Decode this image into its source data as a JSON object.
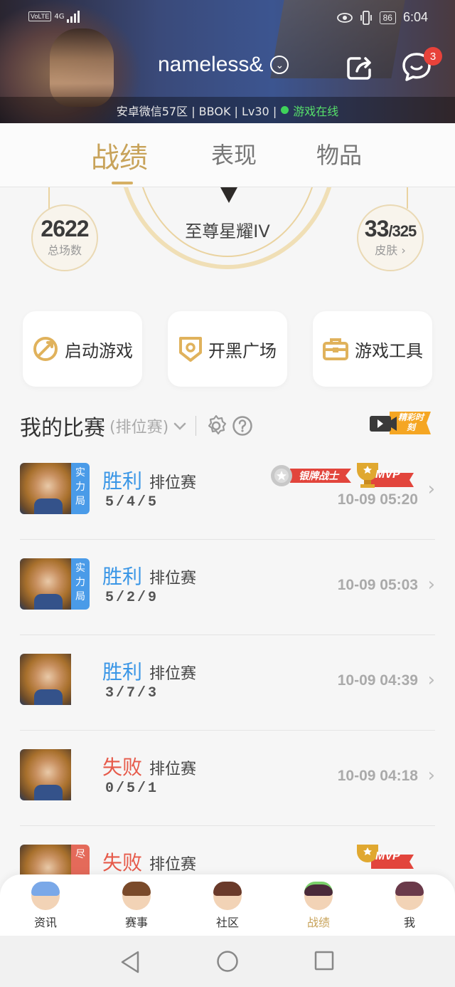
{
  "status_bar": {
    "network": "4G",
    "volte": "VoLTE",
    "battery": "86",
    "time": "6:04"
  },
  "header": {
    "username": "nameless&",
    "message_badge": "3",
    "info_text": "安卓微信57区 | BBOK | Lv30 |",
    "online_text": "游戏在线"
  },
  "tabs": [
    {
      "label": "战绩",
      "active": true
    },
    {
      "label": "表现",
      "active": false
    },
    {
      "label": "物品",
      "active": false
    }
  ],
  "profile_stats": {
    "matches_count": "2622",
    "matches_label": "总场数",
    "rank_name": "至尊星耀IV",
    "skins_owned": "33",
    "skins_total": "/325",
    "skins_label": "皮肤"
  },
  "quick_actions": [
    {
      "label": "启动游戏",
      "icon": "launch-game-icon"
    },
    {
      "label": "开黑广场",
      "icon": "team-plaza-icon"
    },
    {
      "label": "游戏工具",
      "icon": "game-tools-icon"
    }
  ],
  "my_matches": {
    "title": "我的比赛",
    "filter": "(排位赛)",
    "highlight_label": "精彩时刻"
  },
  "matches": [
    {
      "result": "胜利",
      "type": "win",
      "mode": "排位赛",
      "kda": "5/4/5",
      "time": "10-09 05:20",
      "tag": "实力局",
      "badges": [
        "银牌战士",
        "MVP"
      ]
    },
    {
      "result": "胜利",
      "type": "win",
      "mode": "排位赛",
      "kda": "5/2/9",
      "time": "10-09 05:03",
      "tag": "实力局",
      "badges": []
    },
    {
      "result": "胜利",
      "type": "win",
      "mode": "排位赛",
      "kda": "3/7/3",
      "time": "10-09 04:39",
      "tag": "",
      "badges": []
    },
    {
      "result": "失败",
      "type": "lose",
      "mode": "排位赛",
      "kda": "0/5/1",
      "time": "10-09 04:18",
      "tag": "",
      "badges": []
    },
    {
      "result": "失败",
      "type": "lose",
      "mode": "排位赛",
      "kda": "",
      "time": "",
      "tag": "尽",
      "badges": [
        "MVP"
      ]
    }
  ],
  "bottom_nav": [
    {
      "label": "资讯",
      "active": false
    },
    {
      "label": "赛事",
      "active": false
    },
    {
      "label": "社区",
      "active": false
    },
    {
      "label": "战绩",
      "active": true
    },
    {
      "label": "我",
      "active": false
    }
  ],
  "colors": {
    "gold": "#c8a35a",
    "win": "#3a96e6",
    "lose": "#e65a4a",
    "online": "#56e06a"
  }
}
